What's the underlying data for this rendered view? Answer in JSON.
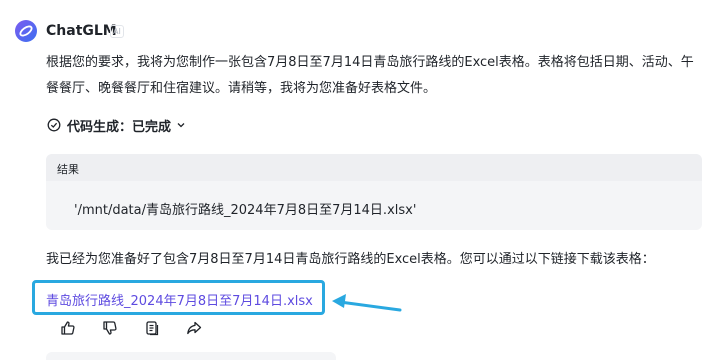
{
  "header": {
    "brand": "ChatGLM",
    "badge": "AI"
  },
  "message": {
    "intro": "根据您的要求，我将为您制作一张包含7月8日至7月14日青岛旅行路线的Excel表格。表格将包括日期、活动、午餐餐厅、晚餐餐厅和住宿建议。请稍等，我将为您准备好表格文件。",
    "code_status": "代码生成：已完成",
    "result_label": "结果",
    "result_value": "'/mnt/data/青岛旅行路线_2024年7月8日至7月14日.xlsx'",
    "followup": "我已经为您准备好了包含7月8日至7月14日青岛旅行路线的Excel表格。您可以通过以下链接下载该表格：",
    "download_link": "青岛旅行路线_2024年7月8日至7月14日.xlsx"
  },
  "actions": [
    "thumbs-up-icon",
    "thumbs-down-icon",
    "copy-icon",
    "share-icon"
  ],
  "colors": {
    "link": "#5e4be0",
    "highlight": "#29a8e0",
    "brand": "#4d5be8"
  }
}
